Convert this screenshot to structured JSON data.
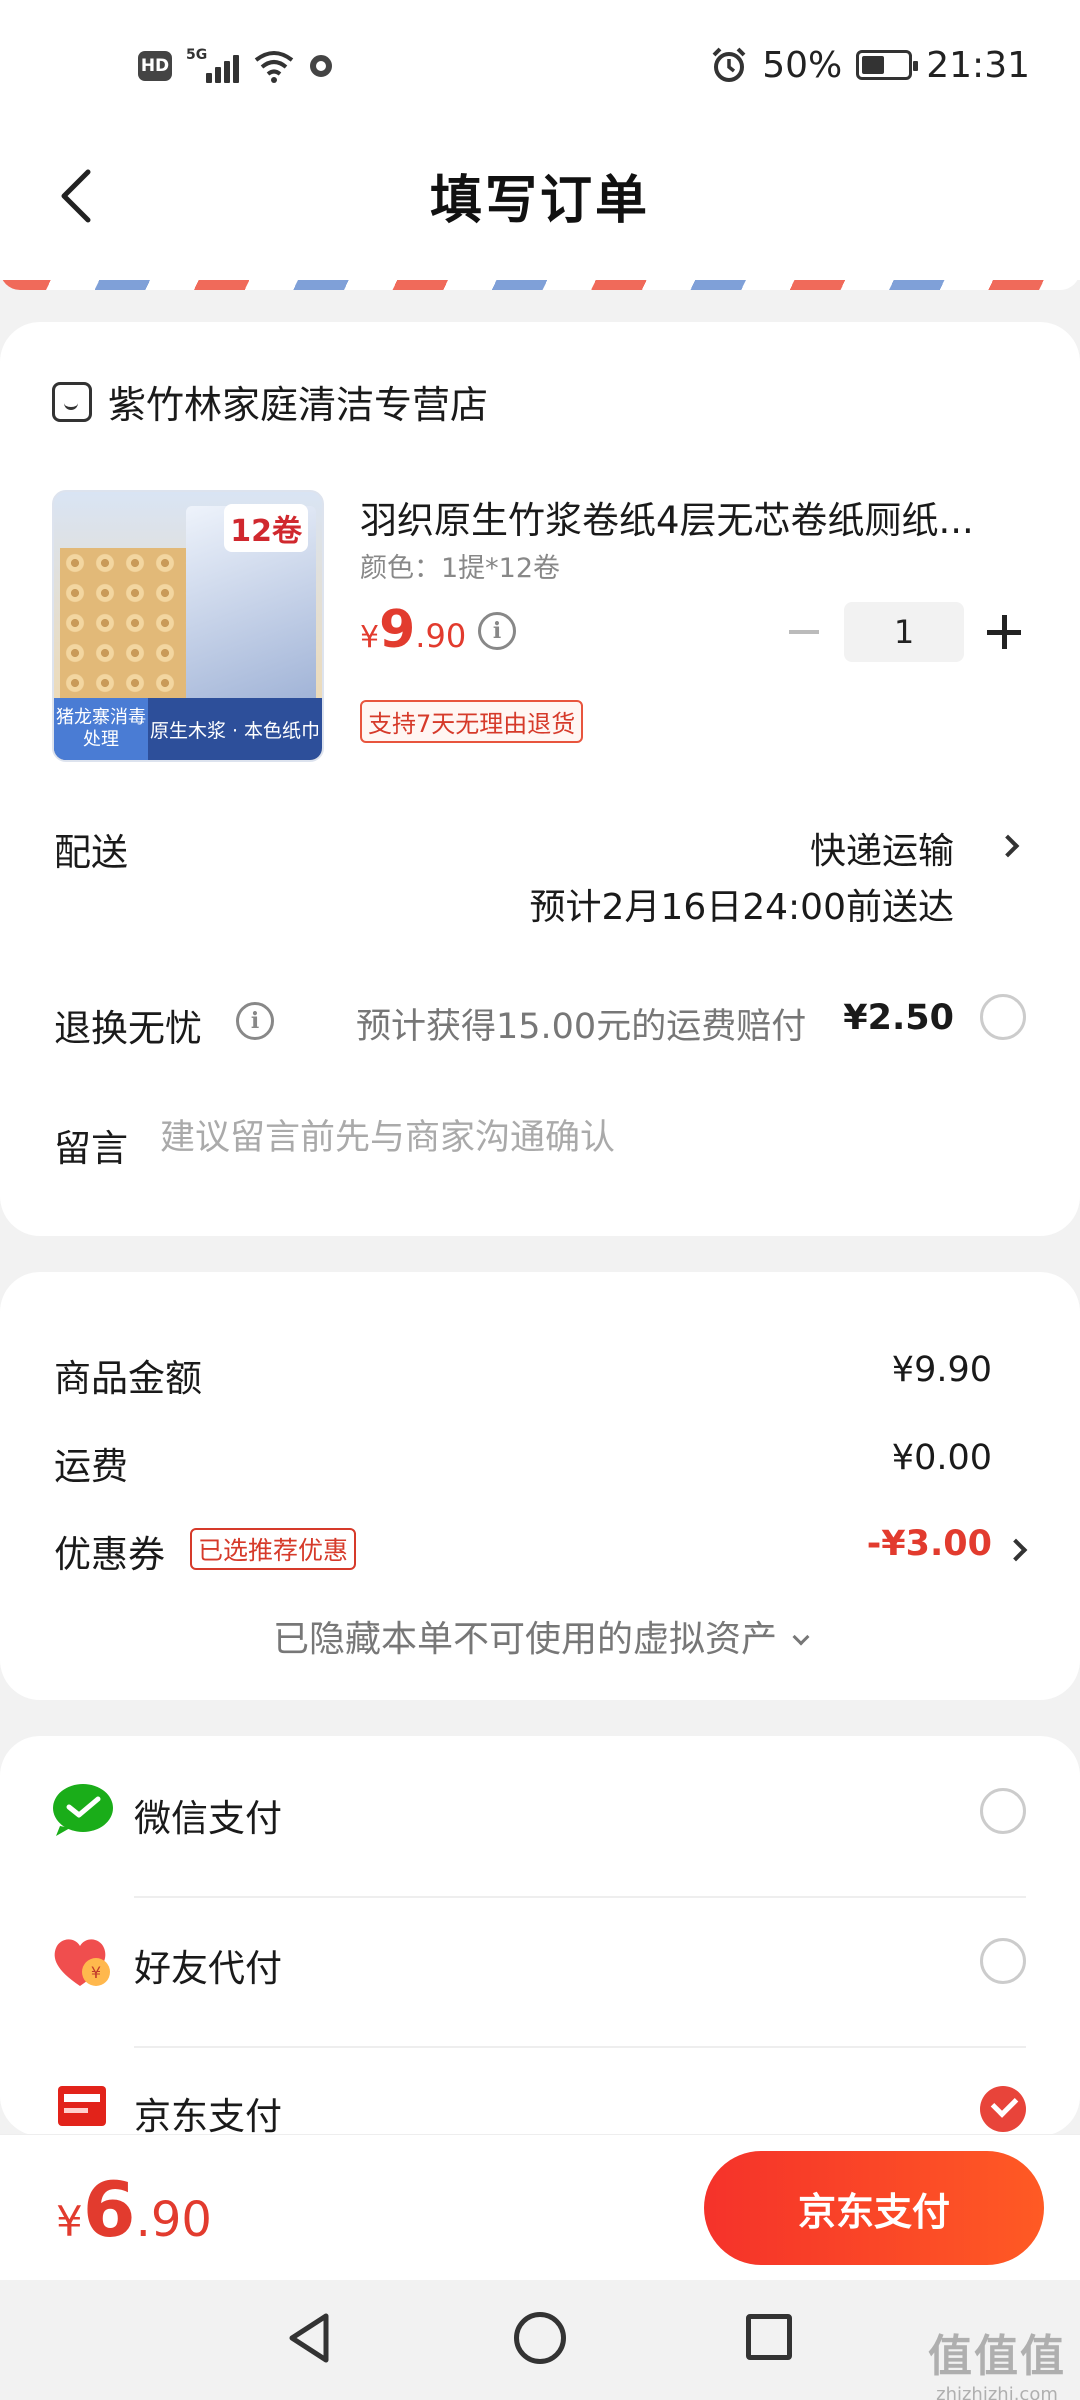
{
  "status_bar": {
    "hd": "HD",
    "network": "5G",
    "battery": "50%",
    "time": "21:31",
    "battery_level": 0.5
  },
  "header": {
    "title": "填写订单"
  },
  "shop": {
    "name": "紫竹林家庭清洁专营店"
  },
  "product": {
    "title": "羽织原生竹浆卷纸4层无芯卷纸厕纸...",
    "spec": "颜色：1提*12卷",
    "price_currency": "¥",
    "price_int": "9",
    "price_dec": ".90",
    "quantity": "1",
    "return_tag": "支持7天无理由退货",
    "image_badge": "12卷",
    "image_banner_left": "猪龙寨消毒处理",
    "image_banner_right": "原生木浆 · 本色纸巾"
  },
  "delivery": {
    "label": "配送",
    "method": "快递运输",
    "eta": "预计2月16日24:00前送达"
  },
  "return_worry": {
    "label": "退换无忧",
    "desc": "预计获得15.00元的运费赔付",
    "price": "¥2.50",
    "selected": false
  },
  "message": {
    "label": "留言",
    "placeholder": "建议留言前先与商家沟通确认"
  },
  "summary": {
    "goods_label": "商品金额",
    "goods_value": "¥9.90",
    "shipping_label": "运费",
    "shipping_value": "¥0.00",
    "coupon_label": "优惠券",
    "coupon_tag": "已选推荐优惠",
    "coupon_value": "-¥3.00",
    "hidden_assets": "已隐藏本单不可使用的虚拟资产"
  },
  "payment": {
    "methods": [
      {
        "label": "微信支付",
        "icon": "wechat-pay-icon",
        "selected": false
      },
      {
        "label": "好友代付",
        "icon": "friend-pay-icon",
        "selected": false
      },
      {
        "label": "京东支付",
        "icon": "jd-pay-icon",
        "selected": true
      }
    ]
  },
  "bottom": {
    "total_currency": "¥",
    "total_int": "6",
    "total_dec": ".90",
    "pay_button": "京东支付"
  },
  "watermark": {
    "main": "值值值",
    "sub": "zhizhizhi.com"
  },
  "colors": {
    "accent": "#e23b2e",
    "wechat": "#1aad19",
    "button": "#f5322a"
  }
}
